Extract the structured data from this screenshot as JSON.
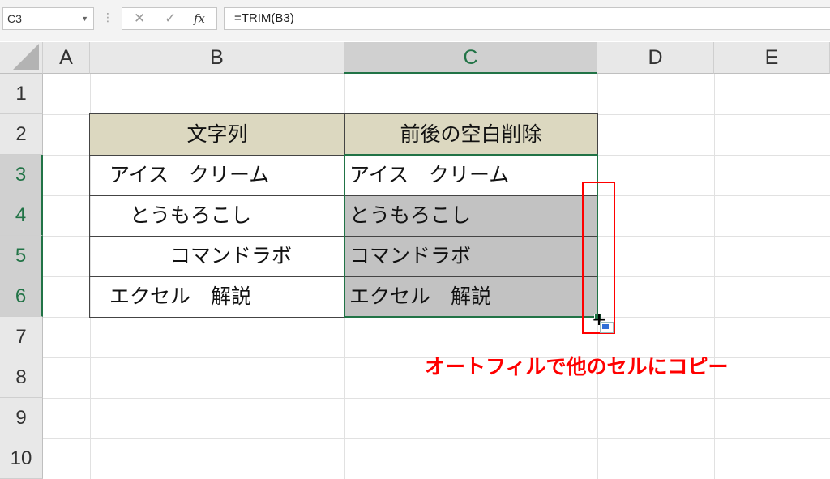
{
  "formula_bar": {
    "name_box": "C3",
    "name_box_arrow": "▼",
    "separator": "⋮",
    "cancel_symbol": "✕",
    "enter_symbol": "✓",
    "fx_label": "fx",
    "formula": "=TRIM(B3)"
  },
  "columns": [
    "A",
    "B",
    "C",
    "D",
    "E"
  ],
  "rows": [
    "1",
    "2",
    "3",
    "4",
    "5",
    "6",
    "7",
    "8",
    "9",
    "10"
  ],
  "selected_column": "C",
  "selected_rows": [
    "3",
    "4",
    "5",
    "6"
  ],
  "table": {
    "header_b": "文字列",
    "header_c": "前後の空白削除",
    "b": [
      "アイス　クリーム",
      "　とうもろこし",
      "　　　コマンドラボ",
      "エクセル　解説"
    ],
    "c": [
      "アイス　クリーム",
      "とうもろこし",
      "コマンドラボ",
      "エクセル　解説"
    ]
  },
  "cursor_symbol": "+",
  "annotation": "オートフィルで他のセルにコピー",
  "colors": {
    "accent_green": "#217346",
    "header_fill": "#dcd8c0",
    "selection_fill": "#c2c2c2",
    "annotation_red": "#ff0000"
  },
  "icons": [
    "dropdown-arrow-icon",
    "cancel-icon",
    "enter-icon",
    "function-icon",
    "select-all-icon",
    "fill-handle-icon",
    "autofill-options-icon"
  ]
}
